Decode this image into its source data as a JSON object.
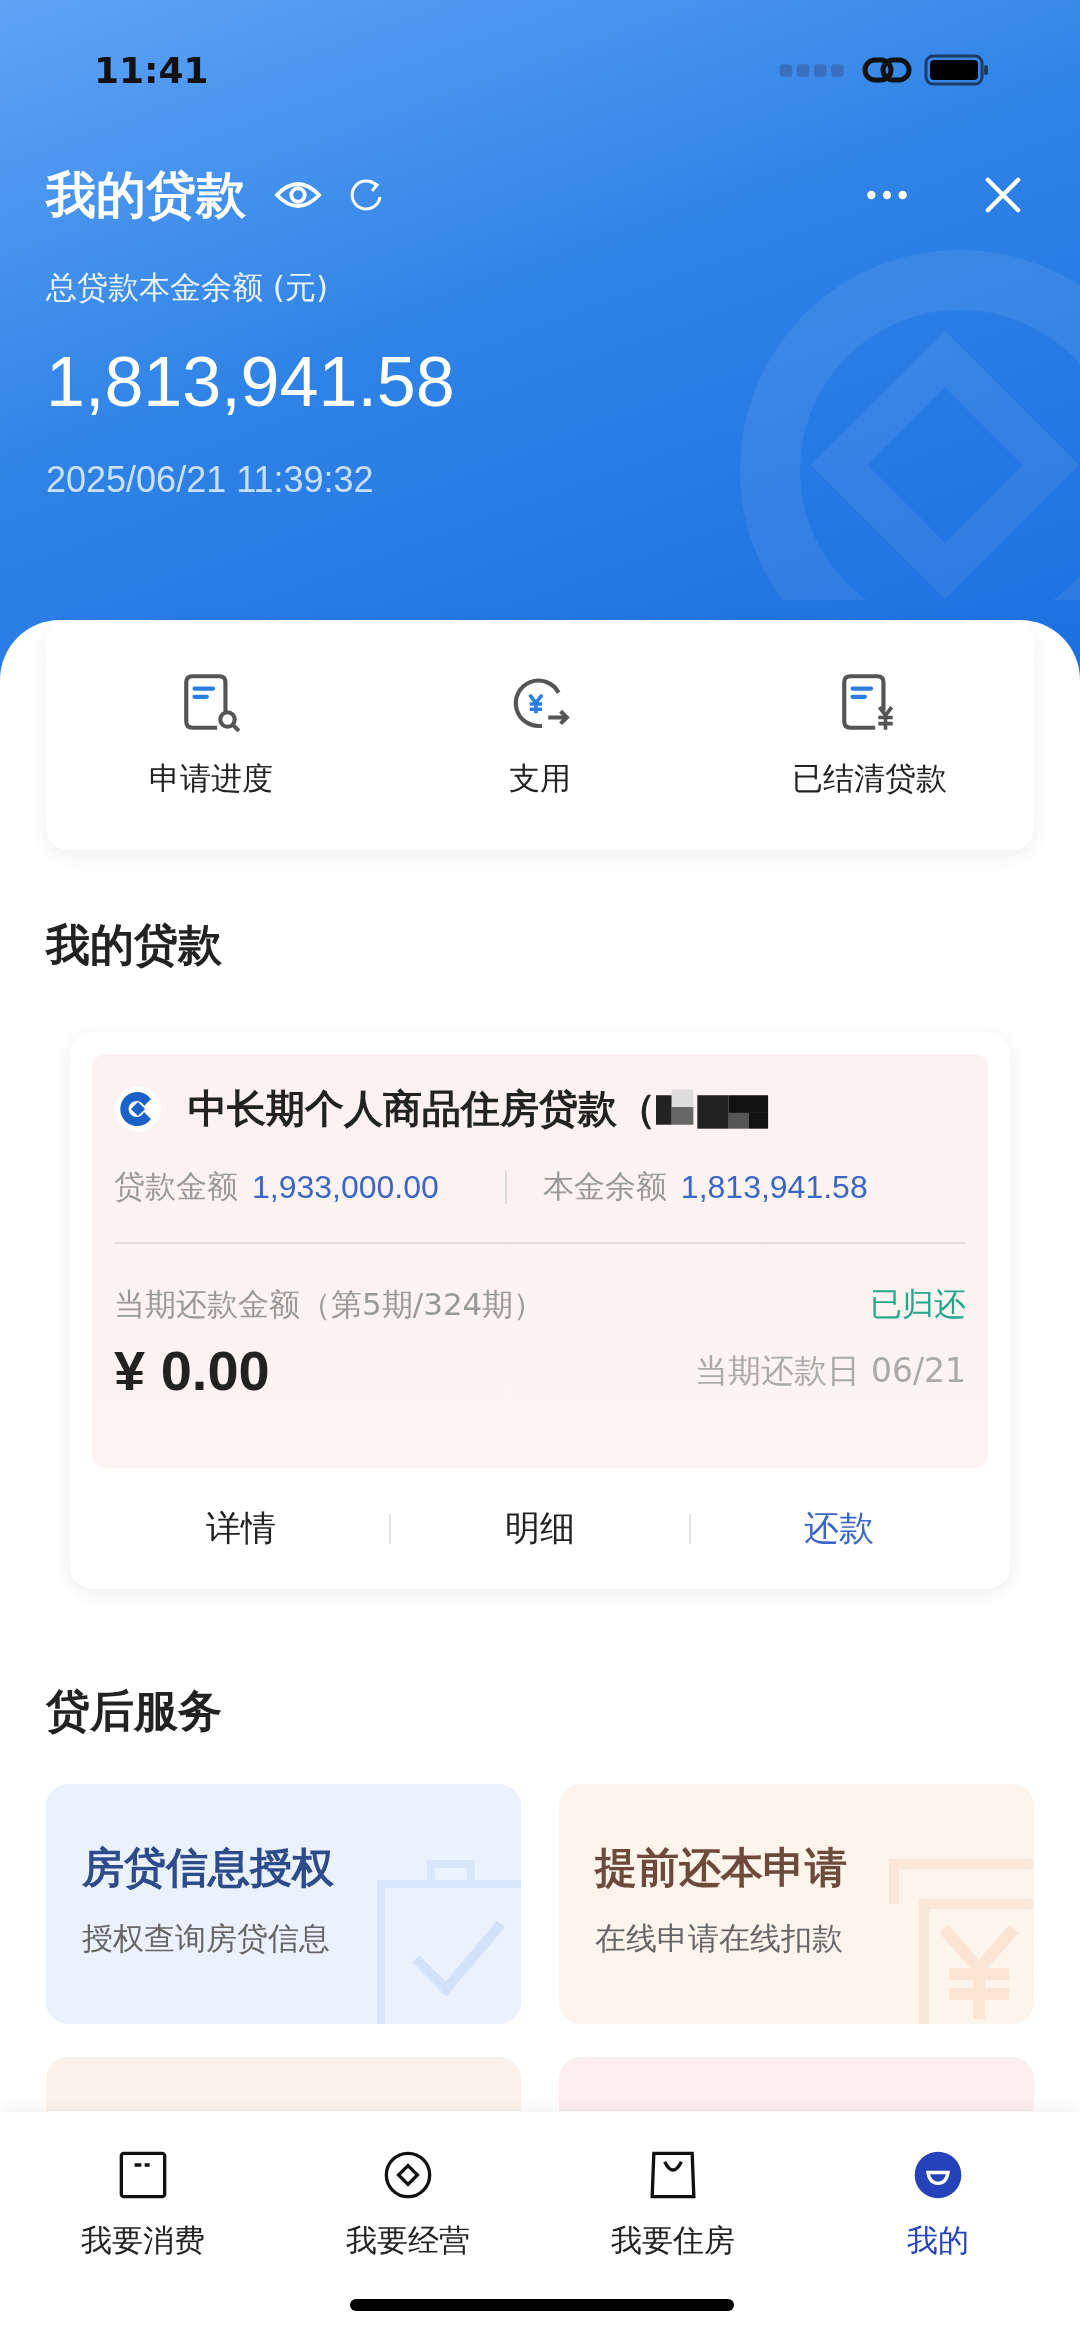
{
  "status_bar": {
    "time": "11:41"
  },
  "header": {
    "title": "我的贷款",
    "balance_label": "总贷款本金余额 (元)",
    "balance": "1,813,941.58",
    "updated": "2025/06/21 11:39:32"
  },
  "quick_actions": [
    {
      "kind": "progress",
      "label": "申请进度"
    },
    {
      "kind": "withdraw",
      "label": "支用"
    },
    {
      "kind": "settled",
      "label": "已结清贷款"
    }
  ],
  "loans_section": {
    "title": "我的贷款"
  },
  "loan": {
    "name": "中长期个人商品住房贷款（",
    "amount_label": "贷款金额",
    "amount": "1,933,000.00",
    "principal_label": "本金余额",
    "principal": "1,813,941.58",
    "period_label": "当期还款金额（第5期/324期）",
    "status": "已归还",
    "payment": "¥ 0.00",
    "due": "当期还款日 06/21",
    "actions": [
      "详情",
      "明细",
      "还款"
    ]
  },
  "services_section": {
    "title": "贷后服务"
  },
  "services": [
    {
      "kind": "authorize",
      "title": "房贷信息授权",
      "subtitle": "授权查询房贷信息"
    },
    {
      "kind": "prepay",
      "title": "提前还本申请",
      "subtitle": "在线申请在线扣款"
    }
  ],
  "partial_cards": [
    {
      "color": "#fdf2ea"
    },
    {
      "color": "#fdeff0"
    }
  ],
  "tabs": [
    {
      "kind": "consume",
      "label": "我要消费",
      "selected": false
    },
    {
      "kind": "business",
      "label": "我要经营",
      "selected": false
    },
    {
      "kind": "housing",
      "label": "我要住房",
      "selected": false
    },
    {
      "kind": "mine",
      "label": "我的",
      "selected": true
    }
  ]
}
